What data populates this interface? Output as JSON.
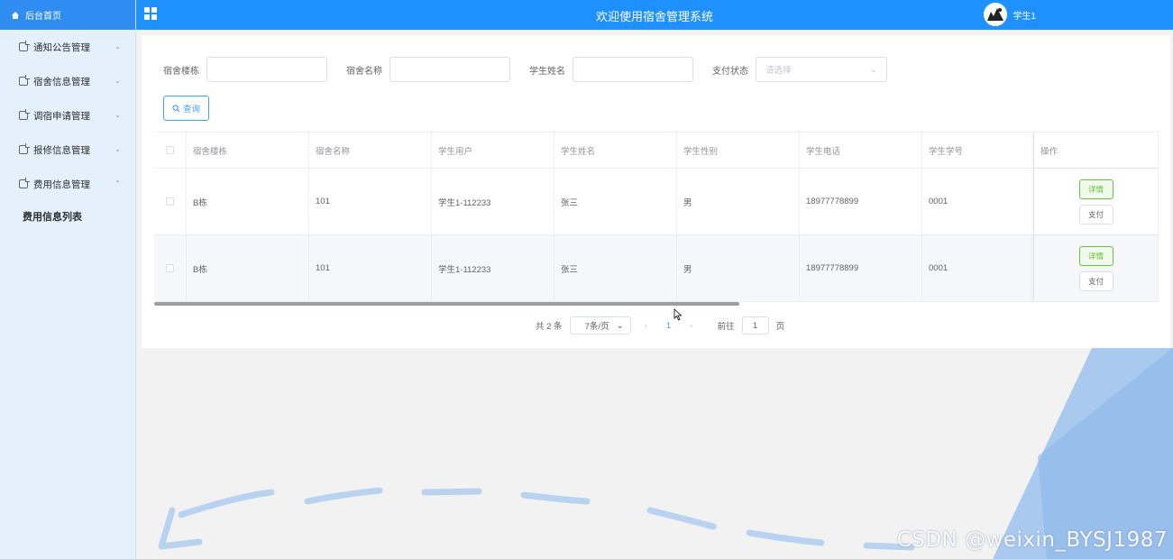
{
  "app": {
    "title": "欢迎使用宿舍管理系统",
    "user_name": "学生1"
  },
  "sidebar": {
    "home_label": "后台首页",
    "items": [
      {
        "label": "通知公告管理",
        "expanded": false
      },
      {
        "label": "宿舍信息管理",
        "expanded": false
      },
      {
        "label": "调宿申请管理",
        "expanded": false
      },
      {
        "label": "报修信息管理",
        "expanded": false
      },
      {
        "label": "费用信息管理",
        "expanded": true
      }
    ],
    "subitem_label": "费用信息列表"
  },
  "search": {
    "building_label": "宿舍楼栋",
    "building_value": "",
    "room_label": "宿舍名称",
    "room_value": "",
    "student_label": "学生姓名",
    "student_value": "",
    "pay_status_label": "支付状态",
    "pay_status_placeholder": "请选择",
    "query_button": "查询"
  },
  "table": {
    "columns": [
      "宿舍楼栋",
      "宿舍名称",
      "学生用户",
      "学生姓名",
      "学生性别",
      "学生电话",
      "学生学号",
      "操作"
    ],
    "rows": [
      {
        "building": "B栋",
        "room": "101",
        "user": "学生1-112233",
        "name": "张三",
        "gender": "男",
        "phone": "18977778899",
        "student_no": "0001"
      },
      {
        "building": "B栋",
        "room": "101",
        "user": "学生1-112233",
        "name": "张三",
        "gender": "男",
        "phone": "18977778899",
        "student_no": "0001"
      }
    ],
    "detail_button": "详情",
    "pay_button": "支付"
  },
  "pagination": {
    "total_text": "共 2 条",
    "page_size": "7条/页",
    "current_page": "1",
    "goto_label": "前往",
    "goto_value": "1",
    "page_suffix": "页"
  },
  "watermark": "CSDN @weixin_BYSJ1987",
  "colors": {
    "header": "#1e90ff",
    "sidebar_bg": "#e4f0fc",
    "primary": "#409eff",
    "success": "#67c23a"
  }
}
